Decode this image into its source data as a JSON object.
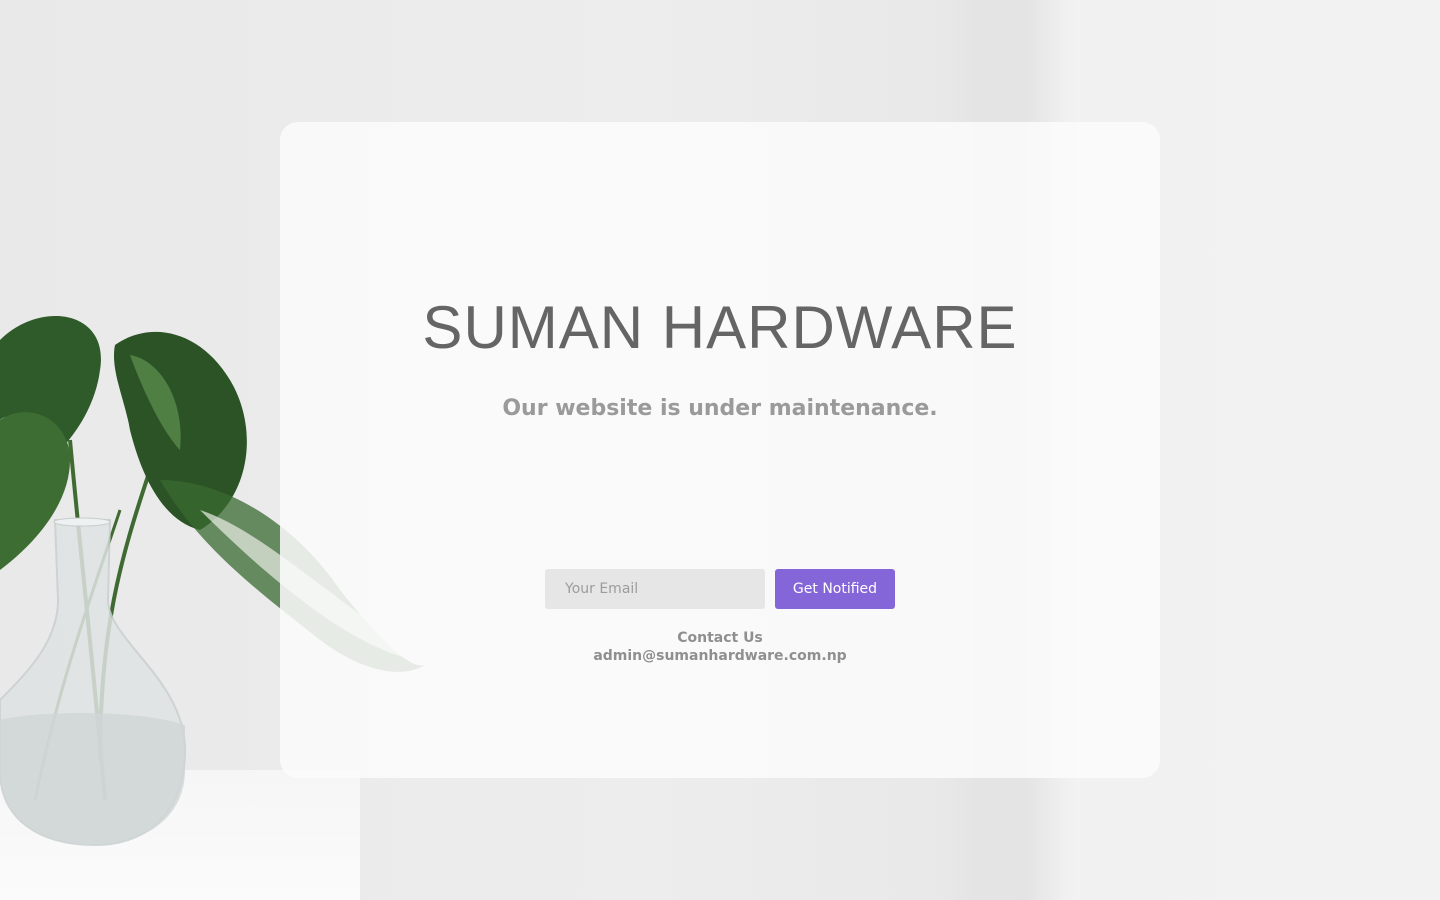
{
  "brand": {
    "title": "SUMAN HARDWARE"
  },
  "main": {
    "subtitle": "Our website is under maintenance."
  },
  "signup": {
    "email_placeholder": "Your Email",
    "email_value": "",
    "button_label": "Get Notified",
    "accent_color": "#8466d9"
  },
  "contact": {
    "label": "Contact Us",
    "email": "admin@sumanhardware.com.np"
  },
  "background": {
    "image": "plant-in-glass-vase-photo"
  }
}
